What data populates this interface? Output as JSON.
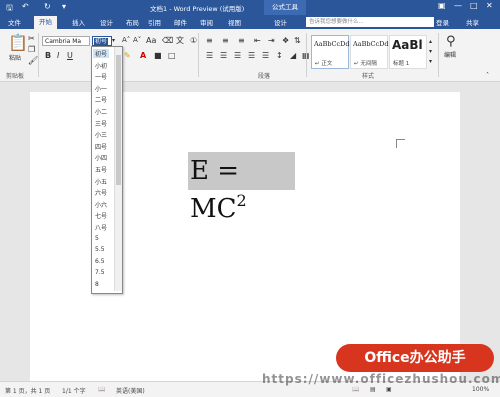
{
  "titlebar": {
    "doc_title": "文档1 - Word Preview (试用版)",
    "contextual_label": "公式工具",
    "save_icon": "save-icon",
    "undo_icon": "undo-icon",
    "redo_icon": "redo-icon",
    "customize_icon": "customize-icon"
  },
  "tabs": {
    "file": "文件",
    "home": "开始",
    "insert": "插入",
    "design": "设计",
    "layout": "布局",
    "references": "引用",
    "mailings": "邮件",
    "review": "审阅",
    "view": "视图",
    "eq_design": "设计",
    "tell_me": "告诉我您想要做什么...",
    "login": "登录",
    "share": "共享"
  },
  "ribbon": {
    "paste_label": "粘贴",
    "clipboard_label": "剪贴板",
    "font_name": "Cambria Ma",
    "font_size_selected": "初号",
    "paragraph_label": "段落",
    "styles_label": "样式",
    "editing_label": "编辑",
    "styles": [
      {
        "preview": "AaBbCcDd",
        "name": "↵ 正文"
      },
      {
        "preview": "AaBbCcDd",
        "name": "↵ 无间隔"
      },
      {
        "preview": "AaBl",
        "name": "标题 1"
      }
    ]
  },
  "font_sizes": [
    "初号",
    "小初",
    "一号",
    "小一",
    "二号",
    "小二",
    "三号",
    "小三",
    "四号",
    "小四",
    "五号",
    "小五",
    "六号",
    "小六",
    "七号",
    "八号",
    "5",
    "5.5",
    "6.5",
    "7.5",
    "8"
  ],
  "document": {
    "equation_main": "E = MC",
    "equation_sup": "2"
  },
  "statusbar": {
    "page": "第 1 页，共 1 页",
    "words": "1/1 个字",
    "language": "英语(美国)",
    "zoom": "100%"
  },
  "watermark": {
    "badge": "Office办公助手",
    "url": "https://www.officezhushou.com"
  },
  "colors": {
    "accent": "#2b579a",
    "watermark_red": "#d8351f"
  }
}
